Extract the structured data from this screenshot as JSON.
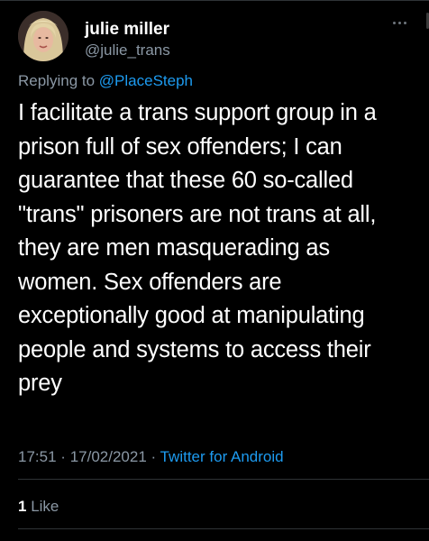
{
  "tweet": {
    "author": {
      "display_name": "julie miller",
      "handle": "@julie_trans",
      "avatar": "avatar-photo"
    },
    "reply": {
      "prefix": "Replying to ",
      "mention": "@PlaceSteph"
    },
    "text": "I facilitate a trans support group in a prison full of sex offenders; I can guarantee that these 60 so-called \"trans\" prisoners are not trans at all, they are men masquerading as women. Sex offenders are exceptionally good at manipulating people and systems to  access their prey",
    "time": "17:51",
    "separator": "·",
    "date": "17/02/2021",
    "source": "Twitter for Android",
    "likes": {
      "count": "1",
      "label": "Like"
    }
  },
  "icons": {
    "more": "more-horizontal-icon"
  },
  "colors": {
    "background": "#000000",
    "text": "#ffffff",
    "secondary": "#8b98a5",
    "link": "#1d9bf0",
    "divider": "#2f3336"
  }
}
